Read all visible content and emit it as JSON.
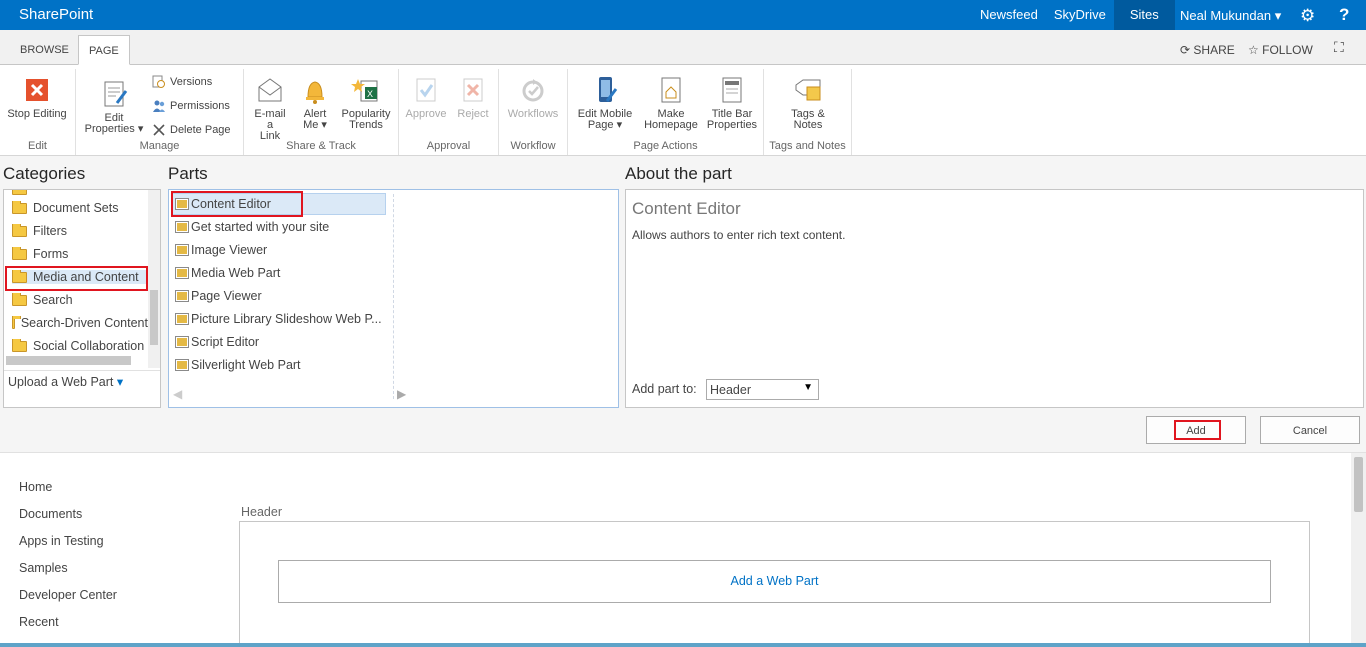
{
  "suitebar": {
    "brand": "SharePoint",
    "links": [
      "Newsfeed",
      "SkyDrive",
      "Sites"
    ],
    "user": "Neal Mukundan",
    "gear": "⚙",
    "help": "?"
  },
  "tabs": {
    "browse": "BROWSE",
    "page": "PAGE",
    "share": "SHARE",
    "follow": "FOLLOW"
  },
  "ribbon": {
    "edit": {
      "label": "Edit",
      "stop_editing": "Stop Editing"
    },
    "manage": {
      "label": "Manage",
      "edit_properties_1": "Edit",
      "edit_properties_2": "Properties",
      "versions": "Versions",
      "permissions": "Permissions",
      "delete_page": "Delete Page"
    },
    "share_track": {
      "label": "Share & Track",
      "email_1": "E-mail a",
      "email_2": "Link",
      "alert_1": "Alert",
      "alert_2": "Me",
      "popularity_1": "Popularity",
      "popularity_2": "Trends"
    },
    "approval": {
      "label": "Approval",
      "approve": "Approve",
      "reject": "Reject"
    },
    "workflow": {
      "label": "Workflow",
      "workflows": "Workflows"
    },
    "page_actions": {
      "label": "Page Actions",
      "mobile_1": "Edit Mobile",
      "mobile_2": "Page",
      "homepage_1": "Make",
      "homepage_2": "Homepage",
      "titlebar_1": "Title Bar",
      "titlebar_2": "Properties"
    },
    "tags": {
      "label": "Tags and Notes",
      "tags_1": "Tags &",
      "tags_2": "Notes"
    }
  },
  "adder": {
    "categories_title": "Categories",
    "parts_title": "Parts",
    "about_title": "About the part",
    "categories": [
      "Document Sets",
      "Filters",
      "Forms",
      "Media and Content",
      "Search",
      "Search-Driven Content",
      "Social Collaboration"
    ],
    "selected_category": "Media and Content",
    "upload": "Upload a Web Part",
    "parts": [
      "Content Editor",
      "Get started with your site",
      "Image Viewer",
      "Media Web Part",
      "Page Viewer",
      "Picture Library Slideshow Web P...",
      "Script Editor",
      "Silverlight Web Part"
    ],
    "selected_part": "Content Editor",
    "about_name": "Content Editor",
    "about_desc": "Allows authors to enter rich text content.",
    "add_part_to": "Add part to:",
    "zone_value": "Header",
    "add_btn": "Add",
    "cancel_btn": "Cancel"
  },
  "nav": [
    "Home",
    "Documents",
    "Apps in Testing",
    "Samples",
    "Developer Center",
    "Recent"
  ],
  "zone": {
    "label": "Header",
    "add_web_part": "Add a Web Part"
  }
}
